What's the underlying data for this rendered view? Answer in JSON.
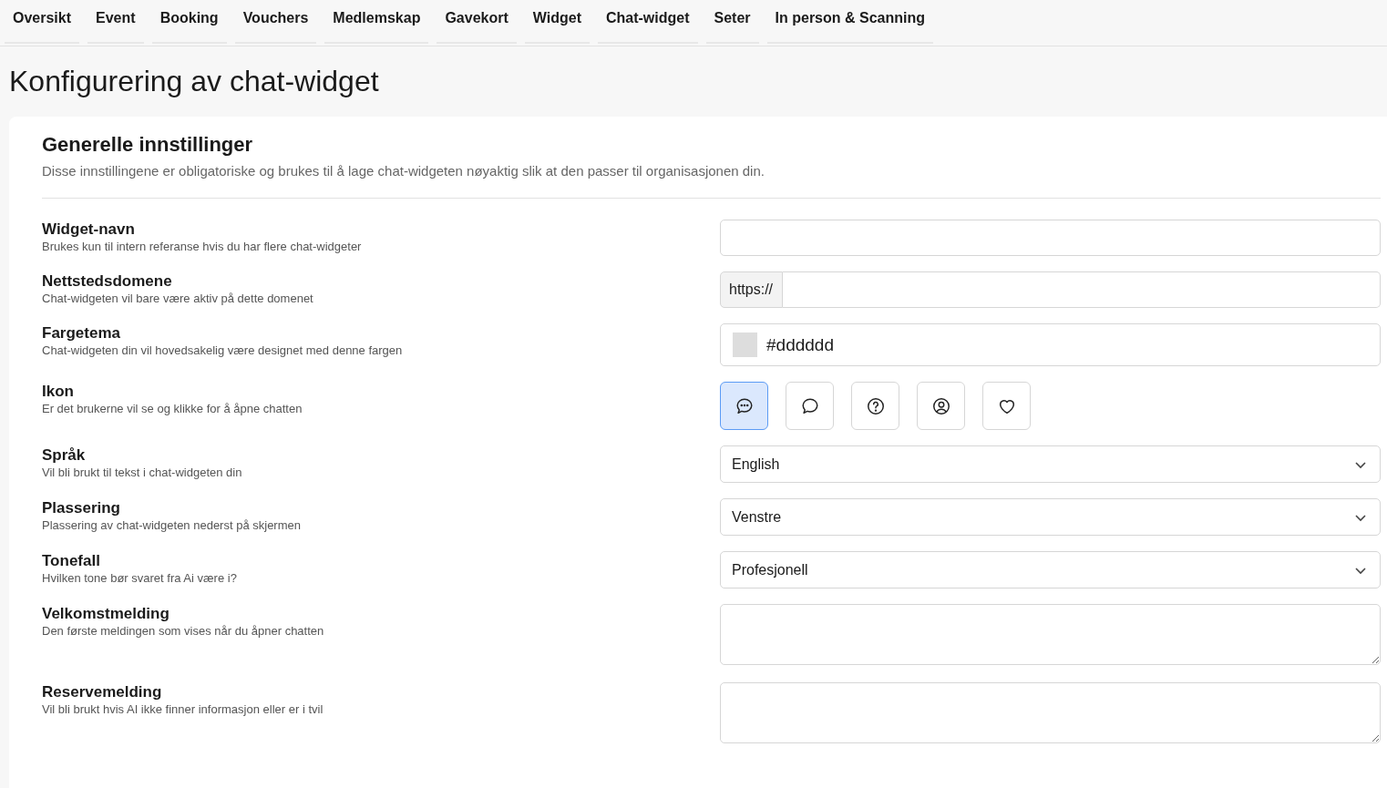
{
  "nav": [
    {
      "label": "Oversikt"
    },
    {
      "label": "Event"
    },
    {
      "label": "Booking"
    },
    {
      "label": "Vouchers"
    },
    {
      "label": "Medlemskap"
    },
    {
      "label": "Gavekort"
    },
    {
      "label": "Widget"
    },
    {
      "label": "Chat-widget"
    },
    {
      "label": "Seter"
    },
    {
      "label": "In person & Scanning"
    }
  ],
  "page_title": "Konfigurering av chat-widget",
  "section": {
    "title": "Generelle innstillinger",
    "description": "Disse innstillingene er obligatoriske og brukes til å lage chat-widgeten nøyaktig slik at den passer til organisasjonen din."
  },
  "fields": [
    {
      "kind": "text",
      "label": "Widget-navn",
      "help": "Brukes kun til intern referanse hvis du har flere chat-widgeter"
    },
    {
      "kind": "prefixed",
      "label": "Nettstedsdomene",
      "help": "Chat-widgeten vil bare være aktiv på dette domenet",
      "prefix": "https://"
    },
    {
      "kind": "color",
      "label": "Fargetema",
      "help": "Chat-widgeten din vil hovedsakelig være designet med denne fargen",
      "value": "#dddddd"
    },
    {
      "kind": "icons",
      "label": "Ikon",
      "help": "Er det brukerne vil se og klikke for å åpne chatten",
      "options": [
        {
          "kind": "chat-dots",
          "selected": true
        },
        {
          "kind": "chat",
          "selected": false
        },
        {
          "kind": "question",
          "selected": false
        },
        {
          "kind": "user",
          "selected": false
        },
        {
          "kind": "heart",
          "selected": false
        }
      ]
    },
    {
      "kind": "select",
      "label": "Språk",
      "help": "Vil bli brukt til tekst i chat-widgeten din",
      "value": "English"
    },
    {
      "kind": "select",
      "label": "Plassering",
      "help": "Plassering av chat-widgeten nederst på skjermen",
      "value": "Venstre"
    },
    {
      "kind": "select",
      "label": "Tonefall",
      "help": "Hvilken tone bør svaret fra Ai være i?",
      "value": "Profesjonell"
    },
    {
      "kind": "textarea",
      "label": "Velkomstmelding",
      "help": "Den første meldingen som vises når du åpner chatten"
    },
    {
      "kind": "textarea",
      "label": "Reservemelding",
      "help": "Vil bli brukt hvis AI ikke finner informasjon eller er i tvil"
    }
  ]
}
